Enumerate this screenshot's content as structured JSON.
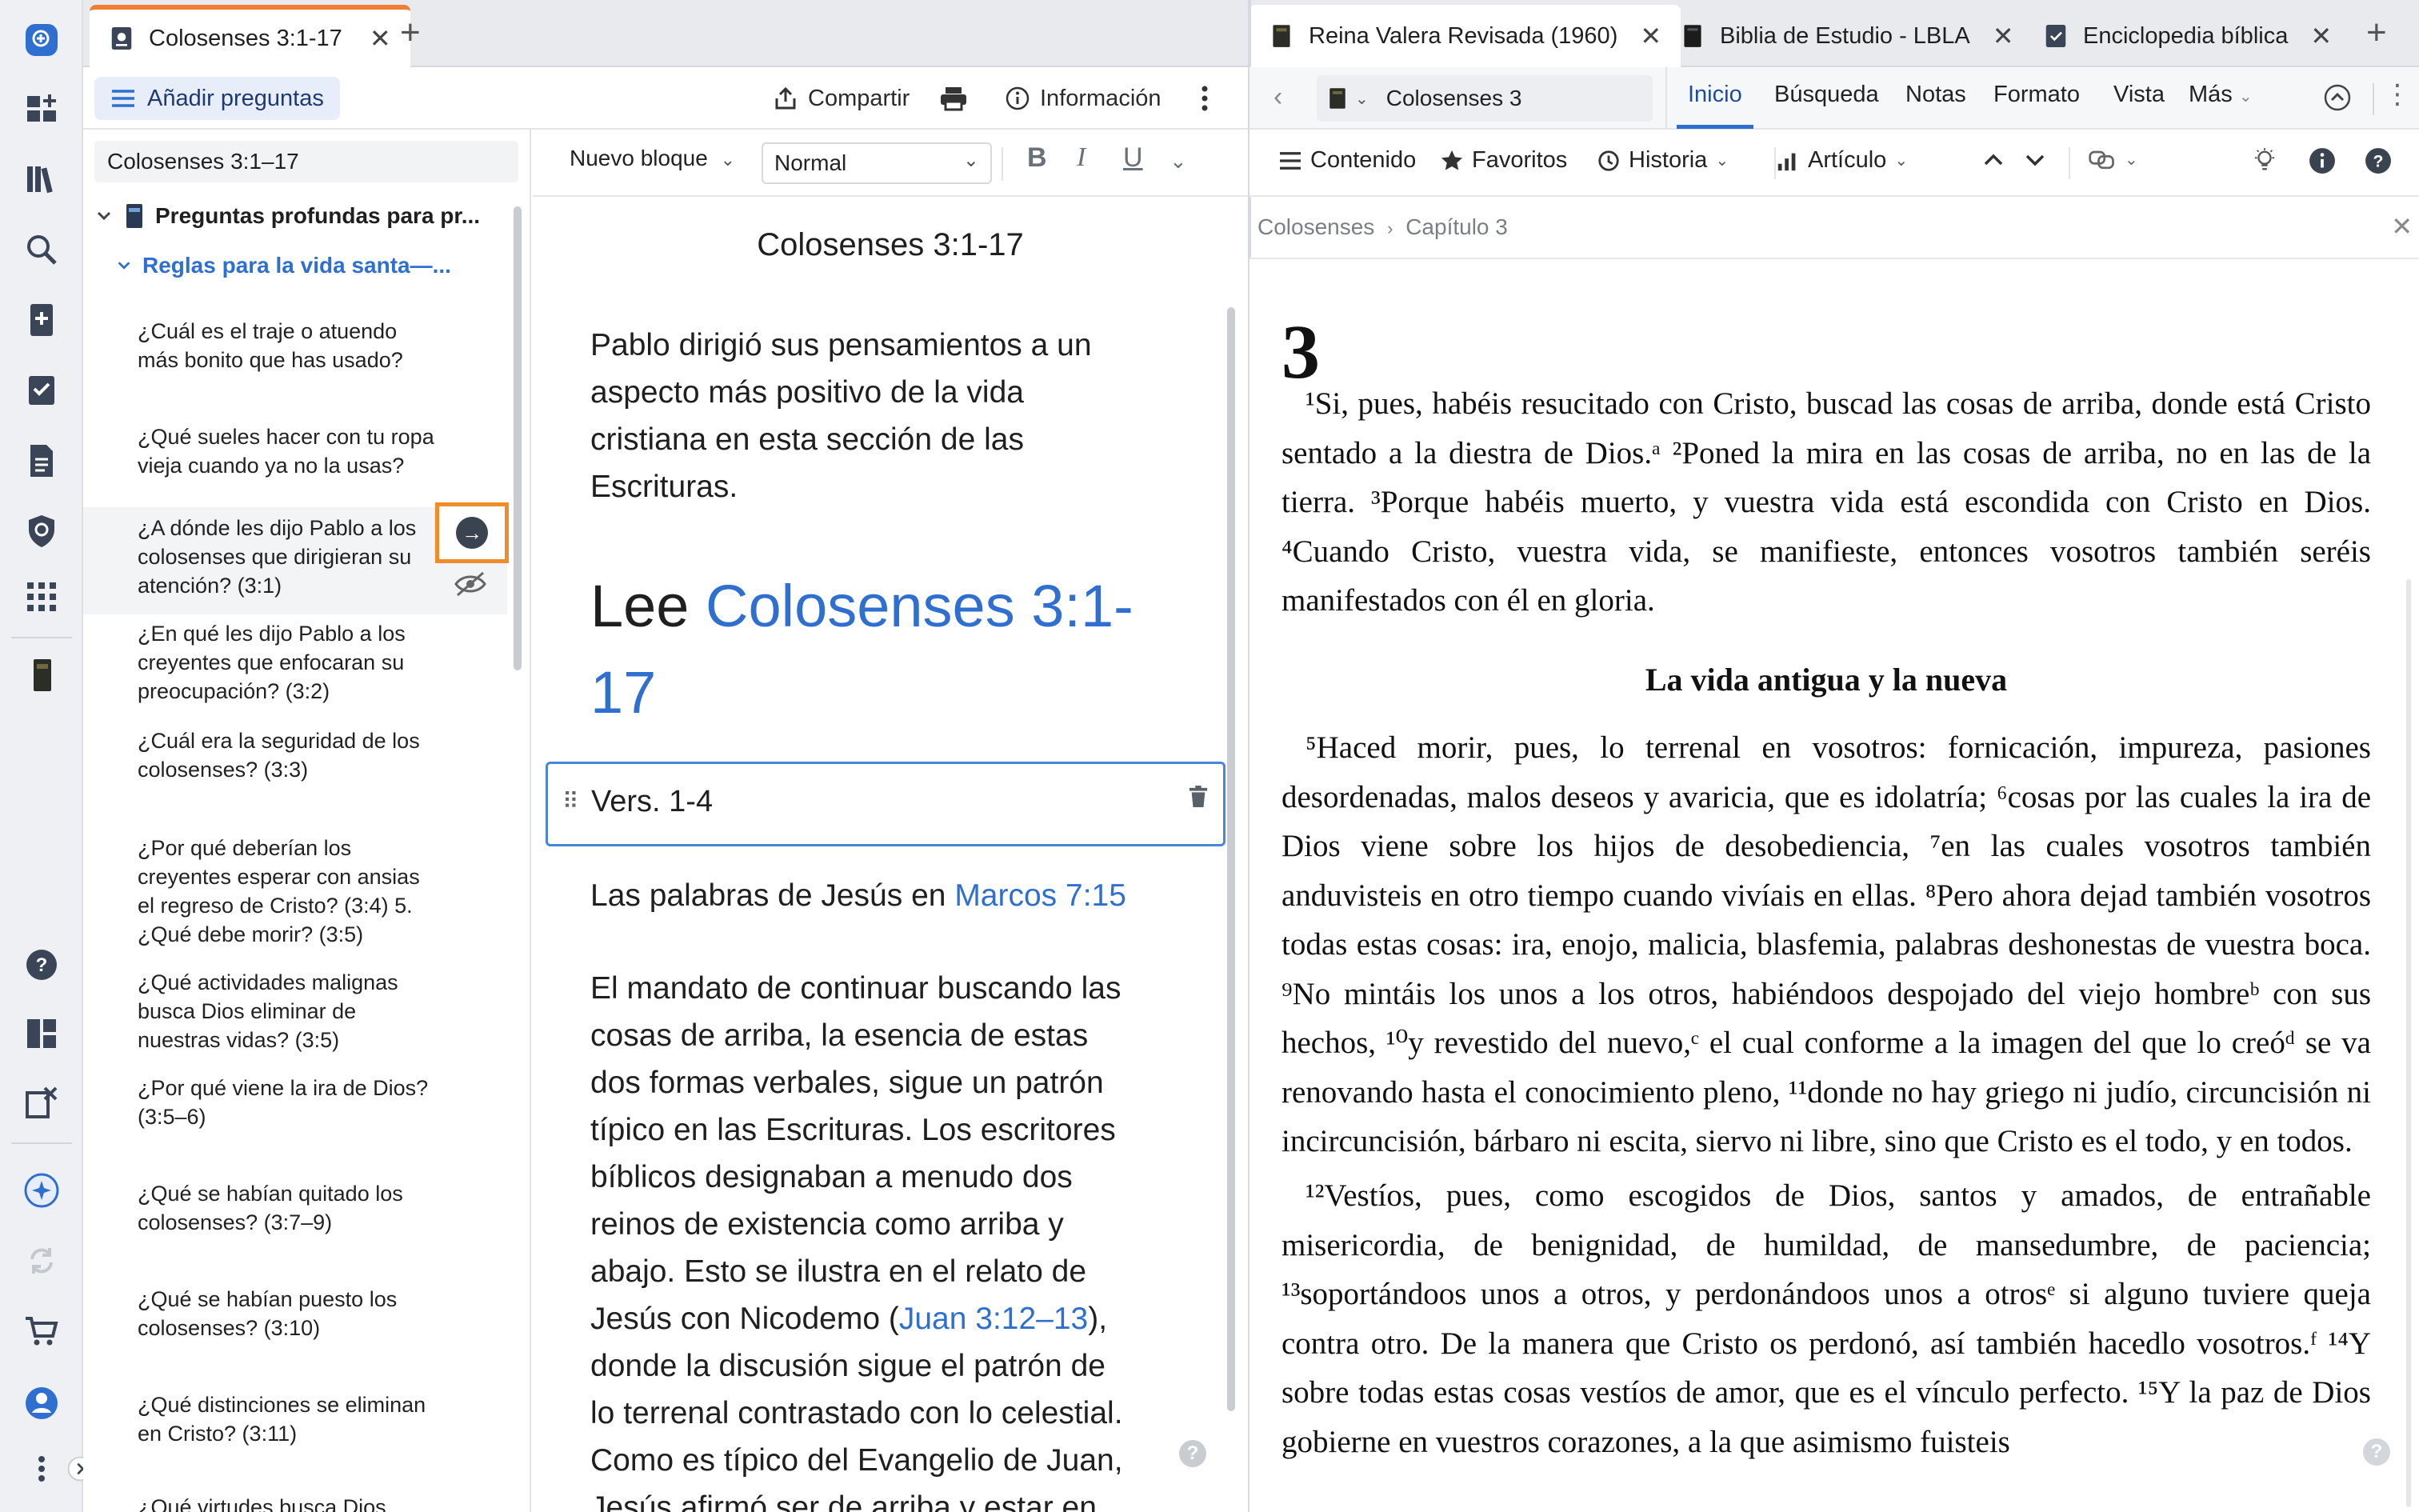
{
  "colors": {
    "accent_orange": "#ef7d34",
    "link_blue": "#2f6fd0",
    "rail_bg": "#eef0f3",
    "highlight_box": "#f08c2a"
  },
  "rail": {
    "icons": [
      "add-icon",
      "dashboard-icon",
      "library-icon",
      "search-icon",
      "notes-add-icon",
      "checklist-icon",
      "document-icon",
      "shield-icon",
      "apps-icon",
      "book-icon",
      "help-icon",
      "layout-icon",
      "clipboard-icon",
      "sparkle-icon",
      "sync-icon",
      "cart-icon",
      "profile-icon",
      "more-icon",
      "expand-icon"
    ]
  },
  "left_tabs": [
    {
      "label": "Colosenses 3:1-17"
    }
  ],
  "right_tabs": [
    {
      "label": "Reina Valera Revisada (1960)"
    },
    {
      "label": "Biblia de Estudio - LBLA"
    },
    {
      "label": "Enciclopedia bíblica"
    }
  ],
  "left_toolbar": {
    "add_questions": "Añadir preguntas",
    "share": "Compartir",
    "info": "Información"
  },
  "questions": {
    "search_value": "Colosenses 3:1–17",
    "root": "Preguntas profundas para pr...",
    "section": "Reglas para la vida santa—...",
    "items": [
      "¿Cuál es el traje o atuendo más bonito que has usado?",
      "¿Qué sueles hacer con tu ropa vieja cuando ya no la usas?",
      "¿A dónde les dijo Pablo a los colosenses que dirigieran su atención? (3:1)",
      "¿En qué les dijo Pablo a los creyentes que enfocaran su preocupación? (3:2)",
      "¿Cuál era la seguridad de los colosenses? (3:3)",
      "¿Por qué deberían los creyentes esperar con ansias el regreso de Cristo? (3:4) 5. ¿Qué debe morir? (3:5)",
      "¿Qué actividades malignas busca Dios eliminar de nuestras vidas? (3:5)",
      "¿Por qué viene la ira de Dios? (3:5–6)",
      "¿Qué se habían quitado los colosenses? (3:7–9)",
      "¿Qué se habían puesto los colosenses? (3:10)",
      "¿Qué distinciones se eliminan en Cristo? (3:11)",
      "¿Qué virtudes busca Dios..."
    ]
  },
  "editor": {
    "block_dropdown": "Nuevo bloque",
    "style_select": "Normal",
    "doc_title": "Colosenses 3:1-17",
    "intro": "Pablo dirigió sus pensamientos a un aspecto más positivo de la vida cristiana en esta sección de las Escrituras.",
    "heading_prefix": "Lee ",
    "heading_link": "Colosenses 3:1-17",
    "block_label": "Vers. 1-4",
    "words_prefix": "Las palabras de Jesús en ",
    "words_link": "Marcos 7:15",
    "body1": "El mandato de continuar buscando las cosas de arriba, la esencia de estas dos formas verbales, sigue un patrón típico en las Escrituras. Los escritores bíblicos designaban a menudo dos reinos de existencia como arriba y abajo. Esto se ilustra en el relato de Jesús con Nicodemo (",
    "body_link": "Juan 3:12–13",
    "body2": "), donde la discusión sigue el patrón de lo terrenal contrastado con lo celestial. Como es típico del Evangelio de Juan, Jesús afirmó ser de arriba y estar en misión en"
  },
  "bible_nav": {
    "passage": "Colosenses 3",
    "tabs": [
      "Inicio",
      "Búsqueda",
      "Notas",
      "Formato",
      "Vista",
      "Más"
    ],
    "contents": "Contenido",
    "favorites": "Favoritos",
    "history": "Historia",
    "article": "Artículo",
    "breadcrumb_book": "Colosenses",
    "breadcrumb_chapter": "Capítulo 3"
  },
  "bible": {
    "chapter": "3",
    "p1": "¹Si, pues, habéis resucitado con Cristo, buscad las cosas de arriba, donde está Cristo sentado a la diestra de Dios.ᵃ ²Poned la mira en las cosas de arriba, no en las de la tierra. ³Porque habéis muerto, y vuestra vida está escondida con Cristo en Dios. ⁴Cuando Cristo, vuestra vida, se manifieste, entonces vosotros también seréis manifestados con él en gloria.",
    "heading": "La vida antigua y la nueva",
    "p2": "⁵Haced morir, pues, lo terrenal en vosotros: fornicación, impureza, pasiones desordenadas, malos deseos y avaricia, que es idolatría; ⁶cosas por las cuales la ira de Dios viene sobre los hijos de desobediencia, ⁷en las cuales vosotros también anduvisteis en otro tiempo cuando vivíais en ellas. ⁸Pero ahora dejad también vosotros todas estas cosas: ira, enojo, malicia, blasfemia, palabras deshonestas de vuestra boca. ⁹No mintáis los unos a los otros, habiéndoos despojado del viejo hombreᵇ con sus hechos, ¹⁰y revestido del nuevo,ᶜ el cual conforme a la imagen del que lo creóᵈ se va renovando hasta el conocimiento pleno, ¹¹donde no hay griego ni judío, circuncisión ni incircuncisión, bárbaro ni escita, siervo ni libre, sino que Cristo es el todo, y en todos.",
    "p3": "¹²Vestíos, pues, como escogidos de Dios, santos y amados, de entrañable misericordia, de benignidad, de humildad, de mansedumbre, de paciencia; ¹³soportándoos unos a otros, y perdonándoos unos a otrosᵉ si alguno tuviere queja contra otro. De la manera que Cristo os perdonó, así también hacedlo vosotros.ᶠ ¹⁴Y sobre todas estas cosas vestíos de amor, que es el vínculo perfecto. ¹⁵Y la paz de Dios gobierne en vuestros corazones, a la que asimismo fuisteis"
  }
}
